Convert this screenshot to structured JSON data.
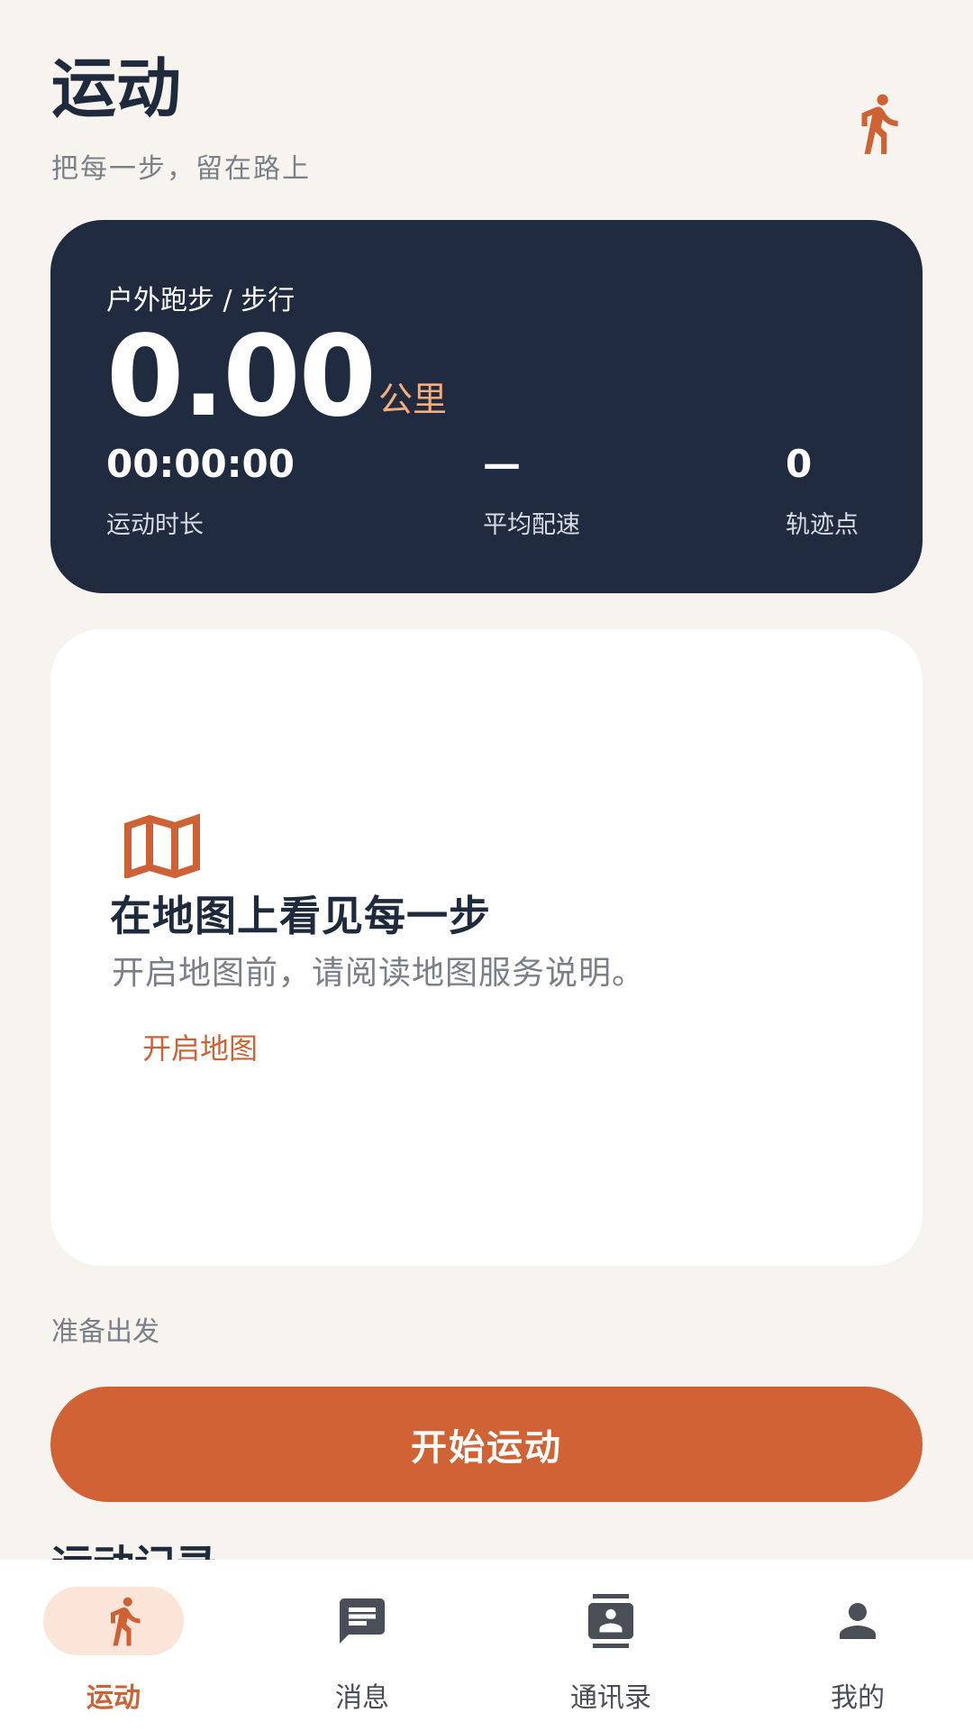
{
  "header": {
    "title": "运动",
    "subtitle": "把每一步，留在路上",
    "icon": "runner-icon"
  },
  "stats": {
    "activity_type": "户外跑步 / 步行",
    "distance": "0.00",
    "distance_unit": "公里",
    "duration_value": "00:00:00",
    "duration_label": "运动时长",
    "pace_value": "—",
    "pace_label": "平均配速",
    "points_value": "0",
    "points_label": "轨迹点"
  },
  "map": {
    "icon": "map-icon",
    "heading": "在地图上看见每一步",
    "description": "开启地图前，请阅读地图服务说明。",
    "enable_label": "开启地图"
  },
  "status": {
    "ready_text": "准备出发"
  },
  "actions": {
    "start_label": "开始运动"
  },
  "history": {
    "heading": "运动记录"
  },
  "nav": {
    "items": [
      {
        "label": "运动",
        "icon": "runner-icon",
        "active": true
      },
      {
        "label": "消息",
        "icon": "message-icon",
        "active": false
      },
      {
        "label": "通讯录",
        "icon": "contacts-icon",
        "active": false
      },
      {
        "label": "我的",
        "icon": "person-icon",
        "active": false
      }
    ]
  },
  "colors": {
    "accent": "#d06235",
    "dark_card": "#202b3f",
    "background": "#f7f4ef",
    "unit_highlight": "#f3ad7e"
  }
}
